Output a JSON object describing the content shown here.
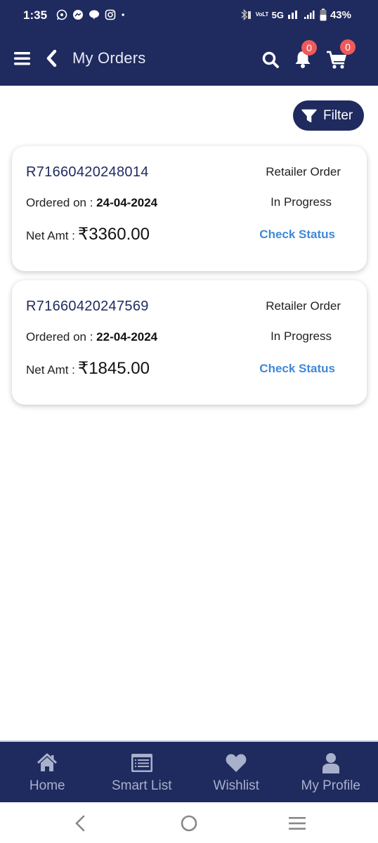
{
  "status_bar": {
    "time": "1:35",
    "app_icons": [
      "whatsapp-icon",
      "messenger-icon",
      "chat-icon",
      "instagram-icon",
      "more-dot-icon"
    ],
    "network_label_top": "VoLTE1",
    "network_5g": "5G",
    "battery": "43%"
  },
  "app_bar": {
    "title": "My Orders",
    "notification_count": "0",
    "cart_count": "0"
  },
  "filter": {
    "label": "Filter"
  },
  "orders": [
    {
      "id": "R71660420248014",
      "ordered_label": "Ordered on : ",
      "date": "24-04-2024",
      "net_label": "Net Amt : ",
      "amount": "₹3360.00",
      "type": "Retailer Order",
      "status": "In Progress",
      "action": "Check Status"
    },
    {
      "id": "R71660420247569",
      "ordered_label": "Ordered on : ",
      "date": "22-04-2024",
      "net_label": "Net Amt : ",
      "amount": "₹1845.00",
      "type": "Retailer Order",
      "status": "In Progress",
      "action": "Check Status"
    }
  ],
  "bottom_nav": [
    {
      "label": "Home",
      "icon": "home-icon"
    },
    {
      "label": "Smart List",
      "icon": "list-icon"
    },
    {
      "label": "Wishlist",
      "icon": "heart-icon"
    },
    {
      "label": "My Profile",
      "icon": "user-icon"
    }
  ],
  "colors": {
    "primary": "#1f2a5e",
    "badge": "#ee5a5a",
    "link": "#3f88d8",
    "nav_inactive": "#a9b0cc"
  }
}
